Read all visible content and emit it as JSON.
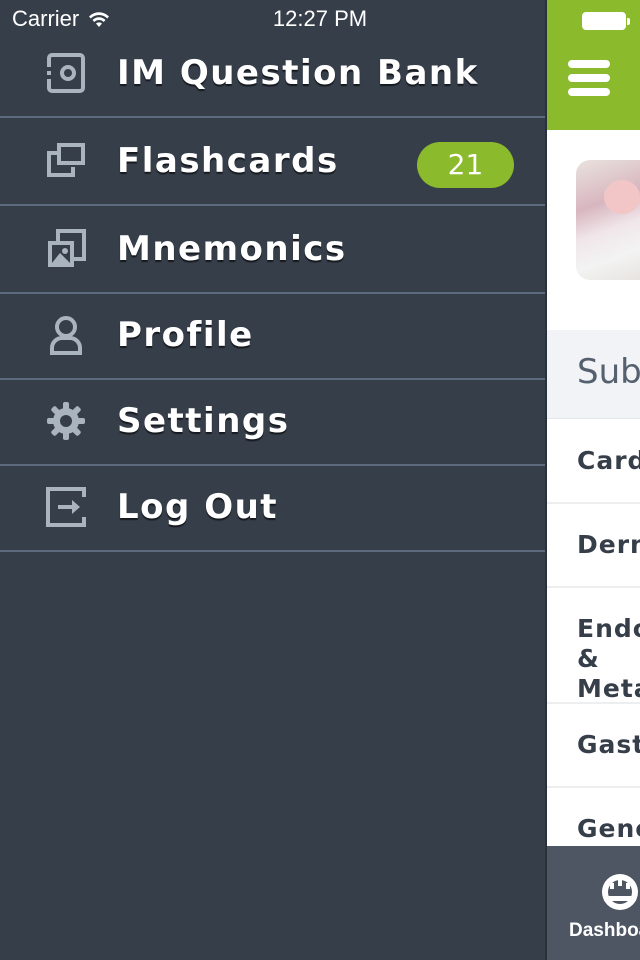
{
  "status_bar": {
    "carrier": "Carrier",
    "time": "12:27 PM",
    "wifi_icon": "wifi-icon",
    "battery_icon": "battery-icon"
  },
  "menu": {
    "items": [
      {
        "label": "IM Question Bank",
        "icon": "question-bank-icon"
      },
      {
        "label": "Flashcards",
        "icon": "flashcards-icon",
        "badge": "21"
      },
      {
        "label": "Mnemonics",
        "icon": "mnemonics-icon"
      },
      {
        "label": "Profile",
        "icon": "profile-icon"
      },
      {
        "label": "Settings",
        "icon": "gear-icon"
      },
      {
        "label": "Log Out",
        "icon": "logout-icon"
      }
    ]
  },
  "main": {
    "menu_button_icon": "hamburger-icon",
    "subjects_header": "Subjects",
    "subjects": [
      "Cardiology",
      "Dermatology",
      "Endocrinology & Metabolism",
      "Gastroenterology",
      "General"
    ],
    "subjects_visible": [
      "Card",
      "Derm",
      "Endo\nMeta",
      "Gast",
      "Gene"
    ],
    "tab_bar": {
      "dashboard_label": "Dashboard",
      "dashboard_icon": "dashboard-icon"
    }
  },
  "colors": {
    "accent": "#8bba2c",
    "menu_bg": "#363e4a",
    "divider": "#5c6a7c",
    "icon": "#aab4be"
  }
}
